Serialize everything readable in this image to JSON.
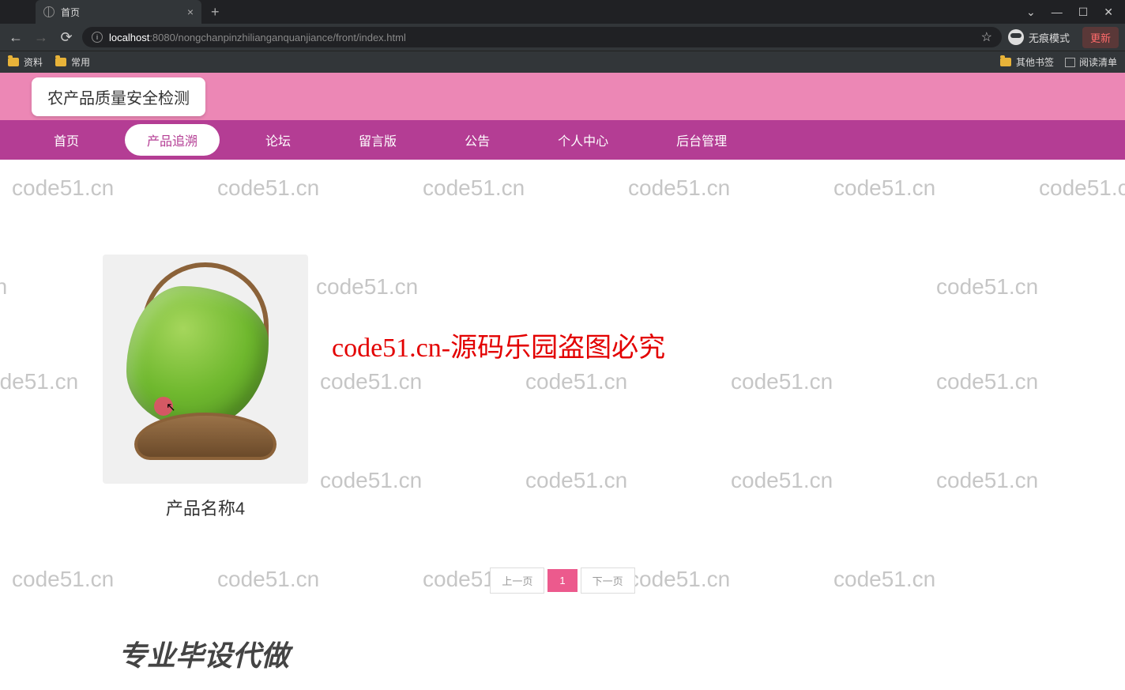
{
  "browser": {
    "tab_title": "首页",
    "url_host": "localhost",
    "url_port": ":8080",
    "url_path": "/nongchanpinzhilianganquanjiance/front/index.html",
    "incognito_label": "无痕模式",
    "update_label": "更新",
    "bookmarks": [
      "资料",
      "常用"
    ],
    "other_bookmarks": "其他书签",
    "reading_list": "阅读清单"
  },
  "header": {
    "title": "农产品质量安全检测"
  },
  "nav": {
    "items": [
      "首页",
      "产品追溯",
      "论坛",
      "留言版",
      "公告",
      "个人中心",
      "后台管理"
    ],
    "active_index": 1
  },
  "product": {
    "name": "产品名称4"
  },
  "watermark_text": "code51.cn",
  "center_text": "code51.cn-源码乐园盗图必究",
  "pagination": {
    "prev": "上一页",
    "current": "1",
    "next": "下一页"
  },
  "footer": "专业毕设代做"
}
